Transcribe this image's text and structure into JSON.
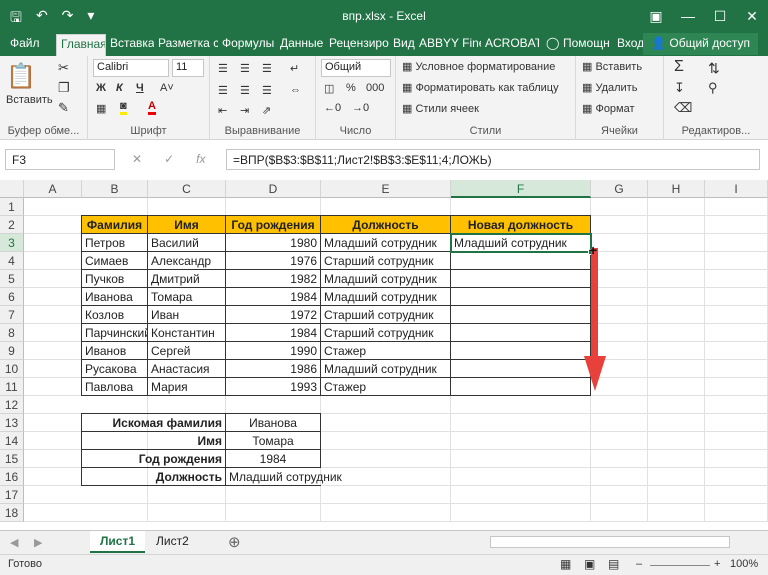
{
  "window": {
    "title": "впр.xlsx - Excel"
  },
  "tabs": [
    "Файл",
    "Главная",
    "Вставка",
    "Разметка ст",
    "Формулы",
    "Данные",
    "Рецензиров",
    "Вид",
    "ABBYY Finel",
    "ACROBAT",
    "Помощн",
    "Вход"
  ],
  "share_label": "Общий доступ",
  "ribbon": {
    "paste": "Вставить",
    "font_name": "Calibri",
    "font_size": "11",
    "number_format": "Общий",
    "cond_format": "Условное форматирование",
    "format_table": "Форматировать как таблицу",
    "cell_styles": "Стили ячеек",
    "insert": "Вставить",
    "delete": "Удалить",
    "format": "Формат",
    "groups": {
      "clipboard": "Буфер обме...",
      "font": "Шрифт",
      "align": "Выравнивание",
      "number": "Число",
      "styles": "Стили",
      "cells": "Ячейки",
      "editing": "Редактиров..."
    }
  },
  "formula_bar": {
    "name_box": "F3",
    "formula": "=ВПР($B$3:$B$11;Лист2!$B$3:$E$11;4;ЛОЖЬ)"
  },
  "columns": [
    "A",
    "B",
    "C",
    "D",
    "E",
    "F",
    "G",
    "H",
    "I"
  ],
  "rows": [
    "1",
    "2",
    "3",
    "4",
    "5",
    "6",
    "7",
    "8",
    "9",
    "10",
    "11",
    "12",
    "13",
    "14",
    "15",
    "16",
    "17",
    "18"
  ],
  "table": {
    "headers": [
      "Фамилия",
      "Имя",
      "Год рождения",
      "Должность",
      "Новая должность"
    ],
    "rows": [
      [
        "Петров",
        "Василий",
        "1980",
        "Младший сотрудник",
        "Младший сотрудник"
      ],
      [
        "Симаев",
        "Александр",
        "1976",
        "Старший сотрудник",
        ""
      ],
      [
        "Пучков",
        "Дмитрий",
        "1982",
        "Младший сотрудник",
        ""
      ],
      [
        "Иванова",
        "Томара",
        "1984",
        "Младший сотрудник",
        ""
      ],
      [
        "Козлов",
        "Иван",
        "1972",
        "Старший сотрудник",
        ""
      ],
      [
        "Парчинский",
        "Константин",
        "1984",
        "Старший сотрудник",
        ""
      ],
      [
        "Иванов",
        "Сергей",
        "1990",
        "Стажер",
        ""
      ],
      [
        "Русакова",
        "Анастасия",
        "1986",
        "Младший сотрудник",
        ""
      ],
      [
        "Павлова",
        "Мария",
        "1993",
        "Стажер",
        ""
      ]
    ]
  },
  "lookup": [
    {
      "label": "Искомая фамилия",
      "value": "Иванова"
    },
    {
      "label": "Имя",
      "value": "Томара"
    },
    {
      "label": "Год рождения",
      "value": "1984"
    },
    {
      "label": "Должность",
      "value": "Младший сотрудник"
    }
  ],
  "sheets": [
    "Лист1",
    "Лист2"
  ],
  "status": {
    "ready": "Готово",
    "zoom": "100%"
  },
  "colors": {
    "excel_green": "#217346",
    "header_fill": "#ffc000",
    "arrow": "#e8403a"
  }
}
